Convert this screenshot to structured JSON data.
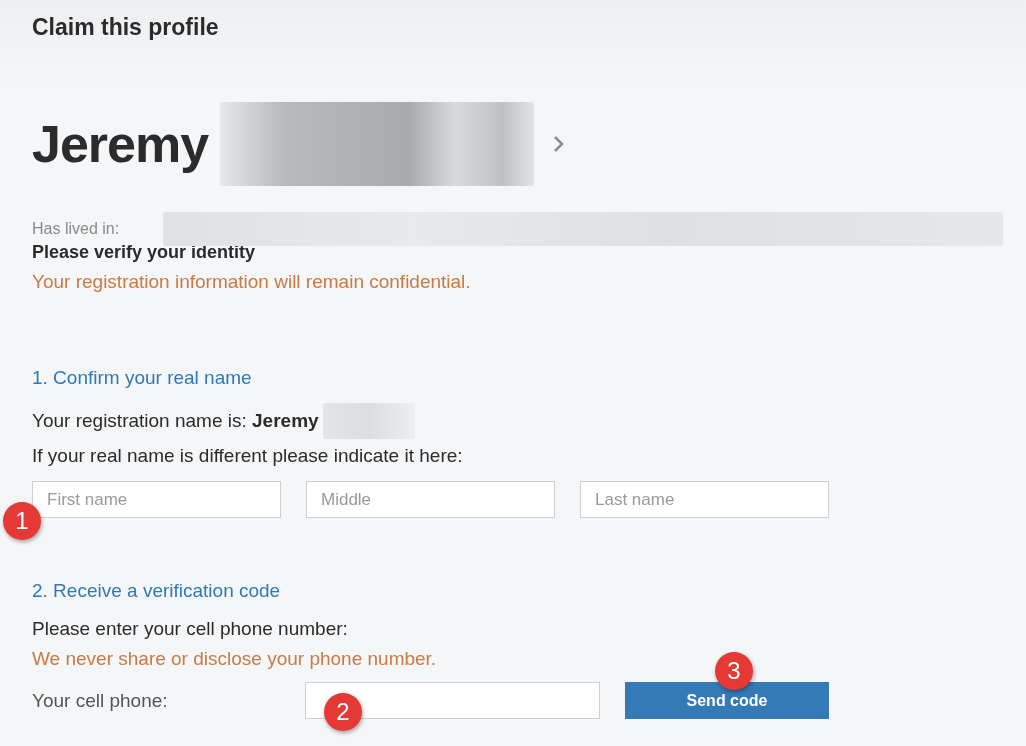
{
  "page_title": "Claim this profile",
  "profile": {
    "first_name": "Jeremy",
    "has_lived_in_label": "Has lived in:"
  },
  "verify": {
    "title": "Please verify your identity",
    "note": "Your registration information will remain confidential."
  },
  "step_1": {
    "heading": "1. Confirm your real name",
    "registration_text": "Your registration name is: **Jeremy**",
    "instruction": "If your real name is different please indicate it here:",
    "fields": [
      {
        "placeholder": "First name"
      },
      {
        "placeholder": "Middle"
      },
      {
        "placeholder": "Last name"
      }
    ]
  },
  "step_2": {
    "heading": "2. Receive a verification code",
    "instruction": "Please enter your cell phone number:",
    "note": "We never share or disclose your phone number.",
    "phone_label": "Your cell phone:",
    "button": "Send code"
  },
  "callouts": [
    "1",
    "2",
    "3"
  ]
}
